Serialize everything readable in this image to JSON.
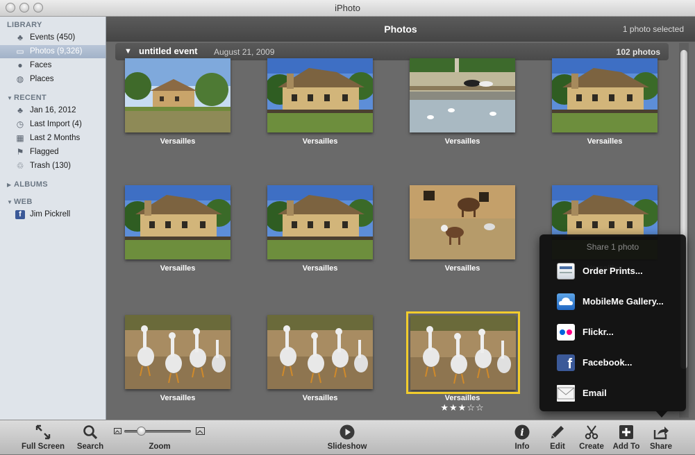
{
  "window": {
    "title": "iPhoto"
  },
  "sidebar": {
    "library_header": "LIBRARY",
    "library": [
      {
        "label": "Events (450)",
        "icon": "events-icon"
      },
      {
        "label": "Photos (9,326)",
        "icon": "photos-icon",
        "selected": true
      },
      {
        "label": "Faces",
        "icon": "faces-icon"
      },
      {
        "label": "Places",
        "icon": "places-icon"
      }
    ],
    "recent_header": "RECENT",
    "recent": [
      {
        "label": "Jan 16, 2012",
        "icon": "event-icon"
      },
      {
        "label": "Last Import (4)",
        "icon": "clock-icon"
      },
      {
        "label": "Last 2 Months",
        "icon": "calendar-icon"
      },
      {
        "label": "Flagged",
        "icon": "flag-icon"
      },
      {
        "label": "Trash (130)",
        "icon": "trash-icon"
      }
    ],
    "albums_header": "ALBUMS",
    "web_header": "WEB",
    "web": [
      {
        "label": "Jim Pickrell",
        "icon": "facebook-icon"
      }
    ]
  },
  "main": {
    "title": "Photos",
    "selection_status": "1 photo selected",
    "event": {
      "name": "untitled event",
      "date": "August 21, 2009",
      "count": "102 photos"
    },
    "photos": [
      {
        "caption": "Versailles",
        "scene": "village"
      },
      {
        "caption": "Versailles",
        "scene": "cottage"
      },
      {
        "caption": "Versailles",
        "scene": "pond"
      },
      {
        "caption": "Versailles",
        "scene": "cottage"
      },
      {
        "caption": "Versailles",
        "scene": "cottage"
      },
      {
        "caption": "Versailles",
        "scene": "cottage"
      },
      {
        "caption": "Versailles",
        "scene": "goats"
      },
      {
        "caption": "Versailles",
        "scene": "cottage"
      },
      {
        "caption": "Versailles",
        "scene": "geese"
      },
      {
        "caption": "Versailles",
        "scene": "geese"
      },
      {
        "caption": "Versailles",
        "scene": "geese",
        "selected": true,
        "rating": "★★★☆☆"
      }
    ]
  },
  "share_popup": {
    "title": "Share 1 photo",
    "items": [
      {
        "label": "Order Prints...",
        "icon": "order-prints-icon"
      },
      {
        "label": "MobileMe Gallery...",
        "icon": "mobileme-icon"
      },
      {
        "label": "Flickr...",
        "icon": "flickr-icon"
      },
      {
        "label": "Facebook...",
        "icon": "facebook-icon"
      },
      {
        "label": "Email",
        "icon": "email-icon"
      }
    ]
  },
  "toolbar": {
    "full_screen": "Full Screen",
    "search": "Search",
    "zoom": "Zoom",
    "zoom_level": 0.25,
    "slideshow": "Slideshow",
    "info": "Info",
    "edit": "Edit",
    "create": "Create",
    "add_to": "Add To",
    "share": "Share"
  },
  "colors": {
    "selection_border": "#f1cc2d",
    "sidebar_bg": "#dfe4ea",
    "main_bg": "#6a6a6a",
    "popup_bg": "#0e0e0e"
  }
}
